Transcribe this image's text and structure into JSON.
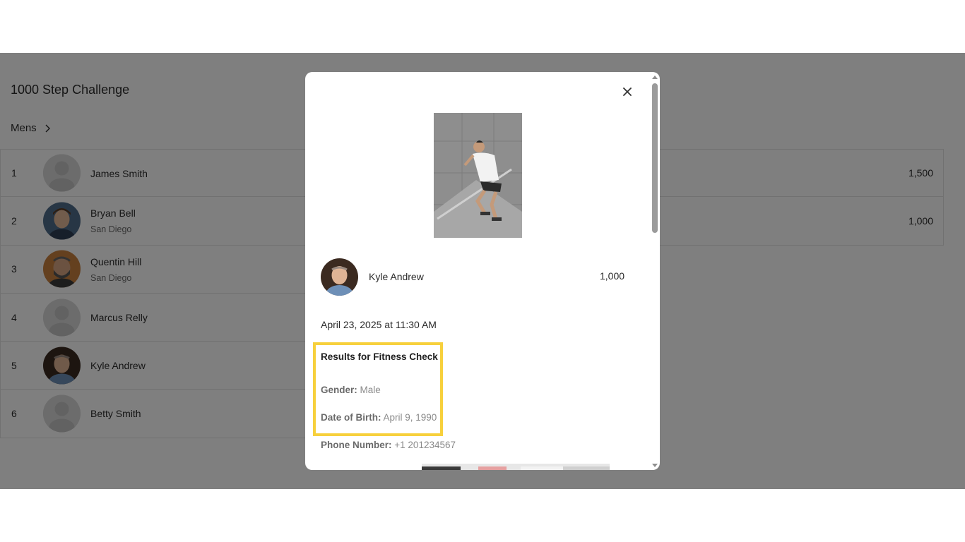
{
  "app": {
    "title": "1000 Step Challenge",
    "breadcrumb": "Mens"
  },
  "leaderboard": [
    {
      "rank": "1",
      "name": "James Smith",
      "city": "",
      "score": "1,500",
      "avatar": "placeholder-avatar"
    },
    {
      "rank": "2",
      "name": "Bryan Bell",
      "city": "San Diego",
      "score": "1,000",
      "avatar": "photo-avatar"
    },
    {
      "rank": "3",
      "name": "Quentin Hill",
      "city": "San Diego",
      "score": "",
      "avatar": "photo-avatar"
    },
    {
      "rank": "4",
      "name": "Marcus Relly",
      "city": "",
      "score": "",
      "avatar": "placeholder-avatar"
    },
    {
      "rank": "5",
      "name": "Kyle Andrew",
      "city": "",
      "score": "",
      "avatar": "photo-avatar"
    },
    {
      "rank": "6",
      "name": "Betty Smith",
      "city": "",
      "score": "",
      "avatar": "placeholder-avatar"
    }
  ],
  "modal": {
    "participant_name": "Kyle Andrew",
    "score": "1,000",
    "timestamp": "April 23, 2025 at 11:30 AM",
    "results_title": "Results for Fitness Check",
    "gender_label": "Gender:",
    "gender_value": "Male",
    "dob_label": "Date of Birth:",
    "dob_value": "April 9, 1990",
    "phone_label": "Phone Number:",
    "phone_value": "+1 201234567"
  },
  "colors": {
    "overlay": "#808080",
    "highlight": "#f7d03c",
    "text": "#2b2b2b",
    "muted": "#8a8a8a"
  }
}
